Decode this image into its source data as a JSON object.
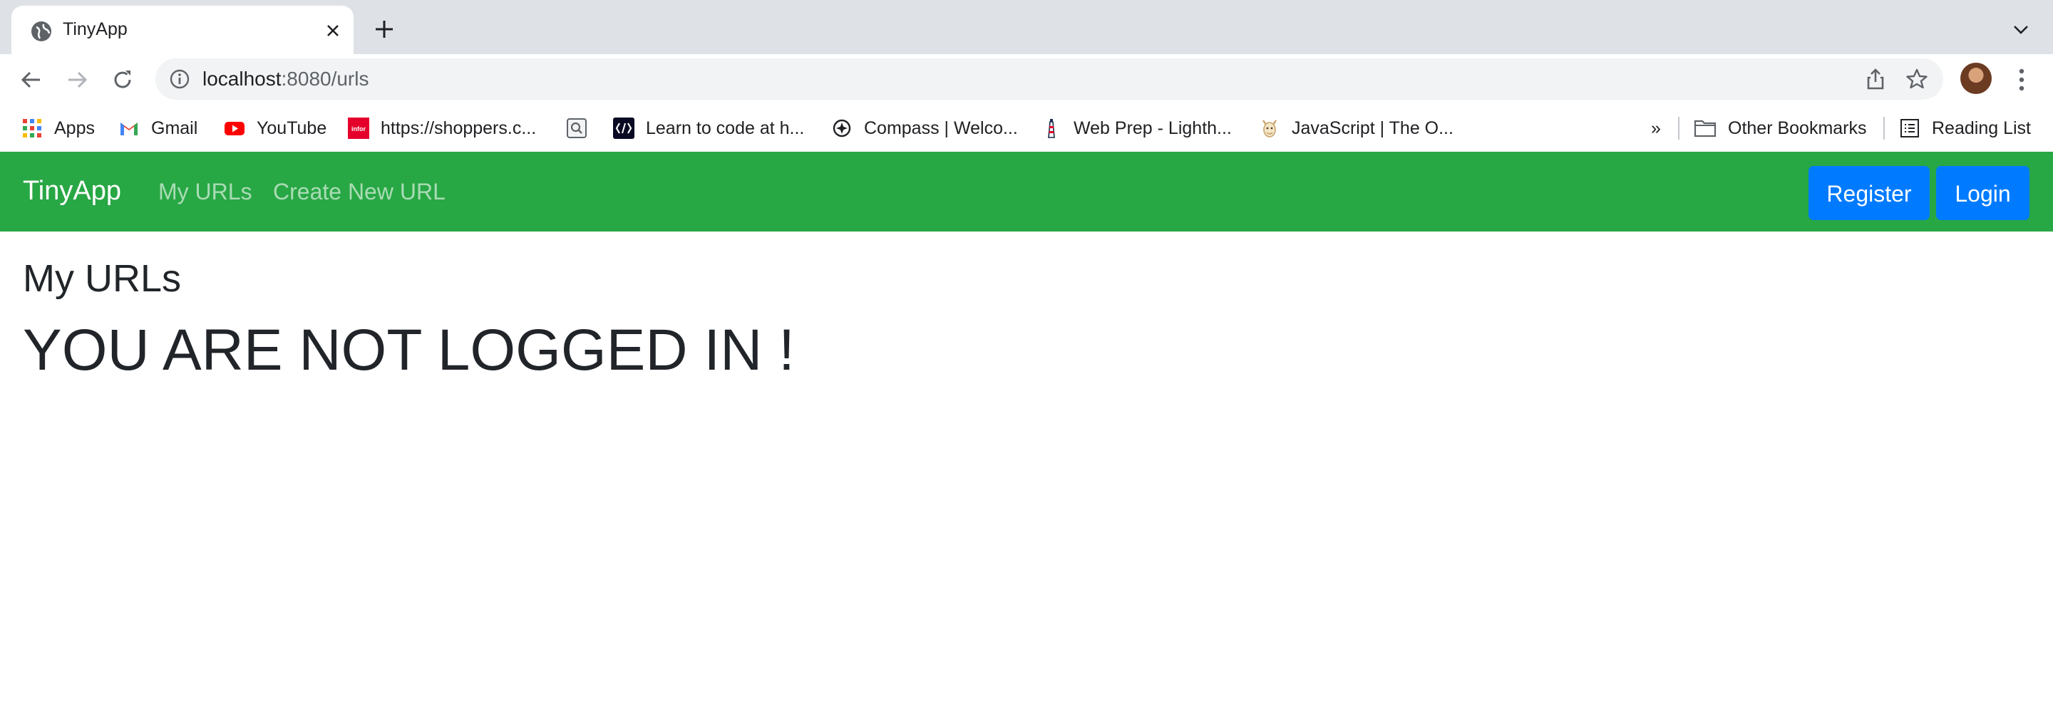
{
  "browser": {
    "tab": {
      "title": "TinyApp"
    },
    "address": {
      "host": "localhost",
      "rest": ":8080/urls"
    },
    "bookmarks": [
      {
        "label": "Apps",
        "icon": "apps-grid-icon"
      },
      {
        "label": "Gmail",
        "icon": "gmail-icon"
      },
      {
        "label": "YouTube",
        "icon": "youtube-icon"
      },
      {
        "label": "https://shoppers.c...",
        "icon": "infor-icon"
      },
      {
        "label": "",
        "icon": "search-bookmark-icon"
      },
      {
        "label": "Learn to code at h...",
        "icon": "code-icon"
      },
      {
        "label": "Compass | Welco...",
        "icon": "compass-icon"
      },
      {
        "label": "Web Prep - Lighth...",
        "icon": "lighthouse-icon"
      },
      {
        "label": "JavaScript | The O...",
        "icon": "odin-icon"
      }
    ],
    "overflow_label": "»",
    "other_bookmarks": "Other Bookmarks",
    "reading_list": "Reading List"
  },
  "navbar": {
    "brand": "TinyApp",
    "links": [
      "My URLs",
      "Create New URL"
    ],
    "register": "Register",
    "login": "Login"
  },
  "main": {
    "heading": "My URLs",
    "message": "YOU ARE NOT LOGGED IN !"
  },
  "colors": {
    "navbar": "#28a745",
    "button": "#007bff",
    "tabstrip": "#dee1e6"
  }
}
